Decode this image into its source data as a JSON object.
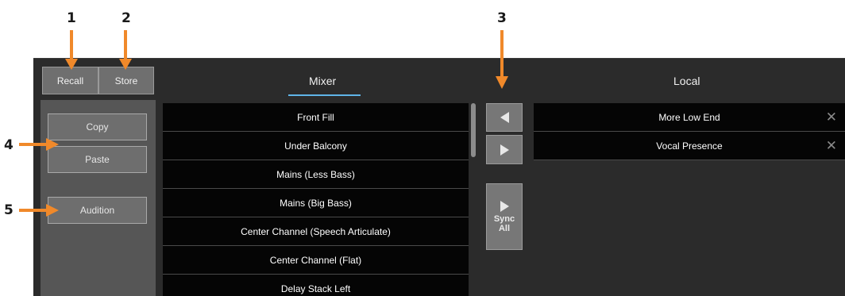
{
  "callouts": [
    "1",
    "2",
    "3",
    "4",
    "5"
  ],
  "top_buttons": {
    "recall": "Recall",
    "store": "Store"
  },
  "sidebar": {
    "copy": "Copy",
    "paste": "Paste",
    "audition": "Audition"
  },
  "tabs": {
    "mixer": "Mixer",
    "local": "Local"
  },
  "mixer_presets": [
    "Front Fill",
    "Under Balcony",
    "Mains (Less Bass)",
    "Mains (Big Bass)",
    "Center Channel (Speech Articulate)",
    "Center Channel (Flat)",
    "Delay Stack Left"
  ],
  "transfer": {
    "sync_line1": "Sync",
    "sync_line2": "All"
  },
  "local_presets": [
    "More Low End",
    "Vocal Presence"
  ],
  "colors": {
    "accent": "#5fb4e8",
    "callout_arrow": "#f0892a",
    "panel": "#2b2b2b"
  },
  "icons": {
    "transfer_left": "triangle-left-icon",
    "transfer_right": "triangle-right-icon",
    "sync_all": "triangle-right-icon",
    "remove": "close-icon"
  }
}
